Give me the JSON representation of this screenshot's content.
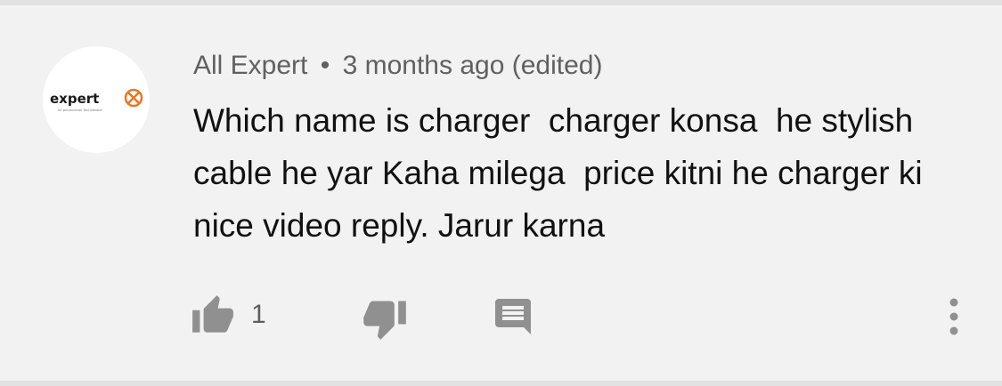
{
  "comment": {
    "author": "All Expert",
    "separator": "•",
    "timestamp": "3 months ago (edited)",
    "text": "Which name is charger  charger konsa  he stylish  cable he yar Kaha milega  price kitni he charger ki nice video reply. Jarur karna"
  },
  "avatar": {
    "logo_text": "expert",
    "logo_tagline": "Ihr persönlicher Fachhändler",
    "logo_color": "#e87722"
  },
  "actions": {
    "like_count": "1"
  },
  "icons": {
    "like": "thumbs-up-icon",
    "dislike": "thumbs-down-icon",
    "reply": "comment-icon",
    "more": "more-vertical-icon"
  },
  "colors": {
    "background": "#f2f2f2",
    "text_primary": "#111111",
    "text_secondary": "#606060",
    "icon": "#909090"
  }
}
